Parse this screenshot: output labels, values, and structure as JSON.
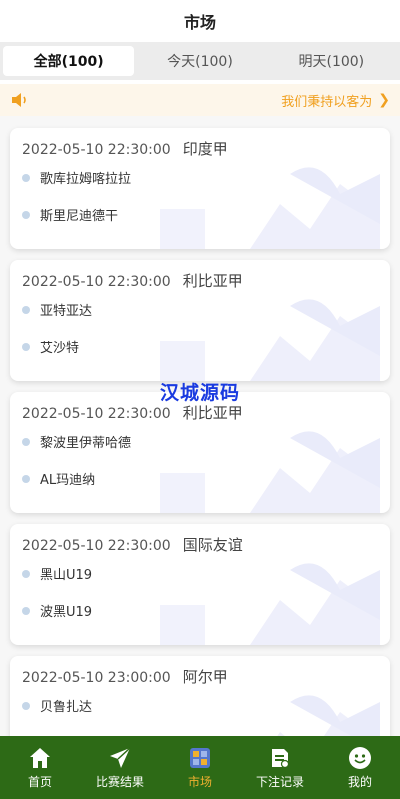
{
  "header": {
    "title": "市场"
  },
  "tabs": [
    {
      "label": "全部(100)",
      "active": true
    },
    {
      "label": "今天(100)",
      "active": false
    },
    {
      "label": "明天(100)",
      "active": false
    }
  ],
  "notice": {
    "icon": "speaker-icon",
    "text": "我们秉持以客为",
    "arrow_icon": "chevron-right-icon"
  },
  "matches": [
    {
      "time": "2022-05-10 22:30:00",
      "league": "印度甲",
      "team1": "歌库拉姆喀拉拉",
      "team2": "斯里尼迪德干"
    },
    {
      "time": "2022-05-10 22:30:00",
      "league": "利比亚甲",
      "team1": "亚特亚达",
      "team2": "艾沙特"
    },
    {
      "time": "2022-05-10 22:30:00",
      "league": "利比亚甲",
      "team1": "黎波里伊蒂哈德",
      "team2": "AL玛迪纳"
    },
    {
      "time": "2022-05-10 22:30:00",
      "league": "国际友谊",
      "team1": "黑山U19",
      "team2": "波黑U19"
    },
    {
      "time": "2022-05-10 23:00:00",
      "league": "阿尔甲",
      "team1": "贝鲁扎达",
      "team2": ""
    }
  ],
  "watermark": "汉城源码",
  "tabbar": [
    {
      "label": "首页",
      "icon": "home-icon",
      "active": false
    },
    {
      "label": "比赛结果",
      "icon": "send-icon",
      "active": false
    },
    {
      "label": "市场",
      "icon": "market-icon",
      "active": true
    },
    {
      "label": "下注记录",
      "icon": "record-icon",
      "active": false
    },
    {
      "label": "我的",
      "icon": "profile-icon",
      "active": false
    }
  ],
  "colors": {
    "accent": "#f0a020",
    "tabbar_bg": "#2d6a16",
    "tabbar_active": "#f0b030",
    "watermark": "#1a3be0"
  }
}
